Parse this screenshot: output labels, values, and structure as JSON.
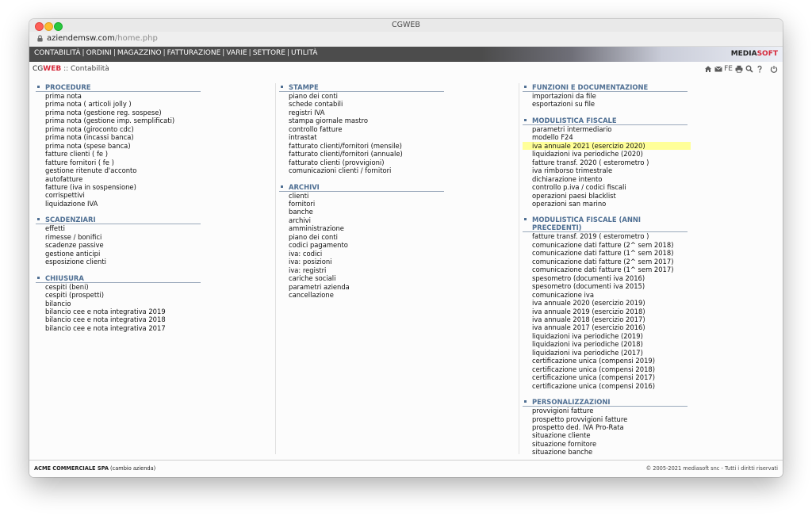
{
  "window": {
    "title": "CGWEB"
  },
  "address": {
    "host": "aziendemsw.com",
    "path": "/home.php"
  },
  "menu": [
    {
      "label": "CONTABILITÀ"
    },
    {
      "label": "ORDINI"
    },
    {
      "label": "MAGAZZINO"
    },
    {
      "label": "FATTURAZIONE"
    },
    {
      "label": "VARIE"
    },
    {
      "label": "SETTORE"
    },
    {
      "label": "UTILITÀ"
    }
  ],
  "brand": {
    "media": "MEDIA",
    "soft": "SOFT"
  },
  "breadcrumb": {
    "cg": "CG",
    "web": "WEB",
    "rest": " :: Contabilità"
  },
  "toolbar": {
    "fe_label": "FE",
    "icons": [
      "home-icon",
      "mail-icon",
      "fe-icon",
      "print-icon",
      "search-icon",
      "help-icon",
      "power-icon"
    ]
  },
  "columns": [
    [
      {
        "title": "PROCEDURE",
        "items": [
          "prima nota",
          "prima nota ( articoli jolly )",
          "prima nota (gestione reg. sospese)",
          "prima nota (gestione imp. semplificati)",
          "prima nota (giroconto cdc)",
          "prima nota (incassi banca)",
          "prima nota (spese banca)",
          "fatture clienti ( fe )",
          "fatture fornitori ( fe )",
          "gestione ritenute d'acconto",
          "autofatture",
          "fatture (iva in sospensione)",
          "corrispettivi",
          "liquidazione IVA"
        ]
      },
      {
        "title": "SCADENZIARI",
        "items": [
          "effetti",
          "rimesse / bonifici",
          "scadenze passive",
          "gestione anticipi",
          "esposizione clienti"
        ]
      },
      {
        "title": "CHIUSURA",
        "items": [
          "cespiti (beni)",
          "cespiti (prospetti)",
          "bilancio",
          "bilancio cee e nota integrativa 2019",
          "bilancio cee e nota integrativa 2018",
          "bilancio cee e nota integrativa 2017"
        ]
      }
    ],
    [
      {
        "title": "STAMPE",
        "items": [
          "piano dei conti",
          "schede contabili",
          "registri IVA",
          "stampa giornale mastro",
          "controllo fatture",
          "intrastat",
          "fatturato clienti/fornitori (mensile)",
          "fatturato clienti/fornitori (annuale)",
          "fatturato clienti (provvigioni)",
          "comunicazioni clienti / fornitori"
        ]
      },
      {
        "title": "ARCHIVI",
        "items": [
          "clienti",
          "fornitori",
          "banche",
          "archivi",
          "amministrazione",
          "piano dei conti",
          "codici pagamento",
          "iva: codici",
          "iva: posizioni",
          "iva: registri",
          "cariche sociali",
          "parametri azienda",
          "cancellazione"
        ]
      }
    ],
    [
      {
        "title": "FUNZIONI E DOCUMENTAZIONE",
        "items": [
          "importazioni da file",
          "esportazioni su file"
        ]
      },
      {
        "title": "MODULISTICA FISCALE",
        "items": [
          "parametri intermediario",
          "modello F24",
          "iva annuale 2021 (esercizio 2020)",
          "liquidazioni iva periodiche (2020)",
          "fatture transf. 2020 ( esterometro )",
          "iva rimborso trimestrale",
          "dichiarazione intento",
          "controllo p.iva / codici fiscali",
          "operazioni paesi blacklist",
          "operazioni san marino"
        ],
        "highlight": 2
      },
      {
        "title": "MODULISTICA FISCALE (ANNI PRECEDENTI)",
        "items": [
          "fatture transf. 2019 ( esterometro )",
          "comunicazione dati fatture (2^ sem 2018)",
          "comunicazione dati fatture (1^ sem 2018)",
          "comunicazione dati fatture (2^ sem 2017)",
          "comunicazione dati fatture (1^ sem 2017)",
          "spesometro (documenti iva 2016)",
          "spesometro (documenti iva 2015)",
          "comunicazione iva",
          "iva annuale 2020 (esercizio 2019)",
          "iva annuale 2019 (esercizio 2018)",
          "iva annuale 2018 (esercizio 2017)",
          "iva annuale 2017 (esercizio 2016)",
          "liquidazioni iva periodiche (2019)",
          "liquidazioni iva periodiche (2018)",
          "liquidazioni iva periodiche (2017)",
          "certificazione unica (compensi 2019)",
          "certificazione unica (compensi 2018)",
          "certificazione unica (compensi 2017)",
          "certificazione unica (compensi 2016)"
        ]
      },
      {
        "title": "PERSONALIZZAZIONI",
        "items": [
          "provvigioni fatture",
          "prospetto provvigioni fatture",
          "prospetto ded. IVA Pro-Rata",
          "situazione cliente",
          "situazione fornitore",
          "situazione banche"
        ]
      }
    ]
  ],
  "footer": {
    "company": "ACME COMMERCIALE SPA",
    "change": " (cambio azienda)",
    "copyright": "© 2005-2021 mediasoft snc - Tutti i diritti riservati"
  },
  "colors": {
    "accent": "#4f6f93",
    "brand_red": "#d5283a",
    "highlight": "#ffff99"
  }
}
